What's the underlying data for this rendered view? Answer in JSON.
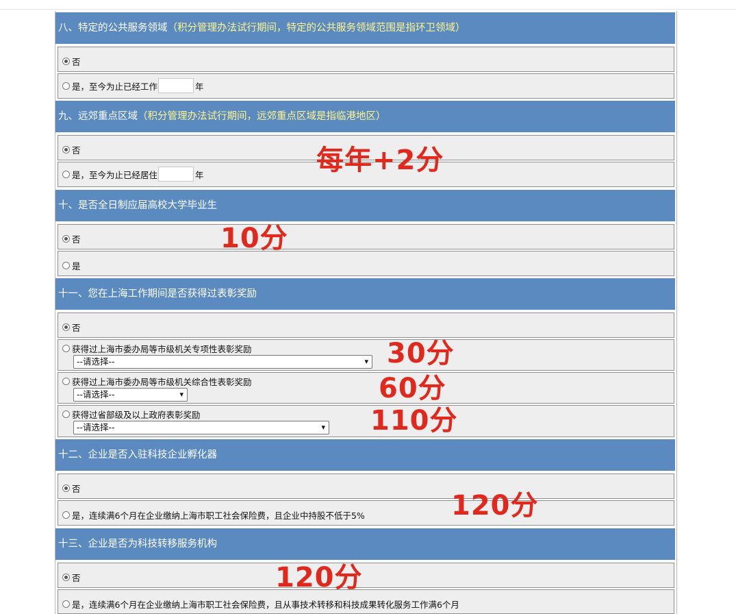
{
  "sections": {
    "s8": {
      "title": "八、特定的公共服务领域",
      "note": "（积分管理办法试行期间，特定的公共服务领域范围是指环卫领域）",
      "opt_no": "否",
      "opt_yes_prefix": "是，至今为止已经工作",
      "opt_yes_unit": "年"
    },
    "s9": {
      "title": "九、远郊重点区域",
      "note": "（积分管理办法试行期间，远郊重点区域是指临港地区）",
      "opt_no": "否",
      "opt_yes_prefix": "是，至今为止已经居住",
      "opt_yes_unit": "年"
    },
    "s10": {
      "title": "十、是否全日制应届高校大学毕业生",
      "opt_no": "否",
      "opt_yes": "是"
    },
    "s11": {
      "title": "十一、您在上海工作期间是否获得过表彰奖励",
      "opt_no": "否",
      "opt_a": "获得过上海市委办局等市级机关专项性表彰奖励",
      "opt_b": "获得过上海市委办局等市级机关综合性表彰奖励",
      "opt_c": "获得过省部级及以上政府表彰奖励",
      "select_placeholder": "--请选择--"
    },
    "s12": {
      "title": "十二、企业是否入驻科技企业孵化器",
      "opt_no": "否",
      "opt_yes": "是，连续满6个月在企业缴纳上海市职工社会保险费，且企业中持股不低于5%"
    },
    "s13": {
      "title": "十三、企业是否为科技转移服务机构",
      "opt_no": "否",
      "opt_yes": "是，连续满6个月在企业缴纳上海市职工社会保险费，且从事技术转移和科技成果转化服务工作满6个月"
    }
  },
  "annotations": {
    "a1": "每年+2分",
    "a2": "10分",
    "a3": "30分",
    "a4": "60分",
    "a5": "110分",
    "a6": "120分",
    "a7": "120分"
  },
  "colors": {
    "header_bg": "#5b8ac0",
    "note_text": "#fff68c",
    "annotation": "#e0281c"
  }
}
